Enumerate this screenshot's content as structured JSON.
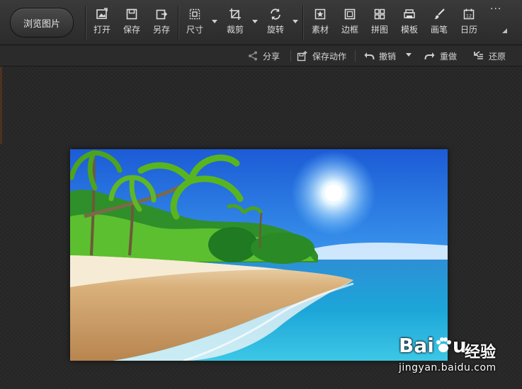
{
  "toolbar": {
    "browse_label": "浏览图片",
    "tools": [
      {
        "label": "打开",
        "icon": "open-icon"
      },
      {
        "label": "保存",
        "icon": "save-icon"
      },
      {
        "label": "另存",
        "icon": "save-as-icon"
      },
      {
        "label": "尺寸",
        "icon": "resize-icon"
      },
      {
        "label": "裁剪",
        "icon": "crop-icon"
      },
      {
        "label": "旋转",
        "icon": "rotate-icon"
      },
      {
        "label": "素材",
        "icon": "material-icon"
      },
      {
        "label": "边框",
        "icon": "border-icon"
      },
      {
        "label": "拼图",
        "icon": "collage-icon"
      },
      {
        "label": "模板",
        "icon": "template-icon"
      },
      {
        "label": "画笔",
        "icon": "brush-icon"
      },
      {
        "label": "日历",
        "icon": "calendar-icon"
      }
    ],
    "more_label": "···"
  },
  "actions": {
    "share": "分享",
    "save_action": "保存动作",
    "undo": "撤销",
    "redo": "重做",
    "restore": "还原"
  },
  "watermark": {
    "logo_text_left": "Bai",
    "logo_text_right": "u",
    "logo_cn": "经验",
    "url": "jingyan.baidu.com"
  },
  "colors": {
    "toolbar_bg": "#2f2f2f",
    "canvas_bg": "#262626",
    "text": "#dcdcdc"
  }
}
